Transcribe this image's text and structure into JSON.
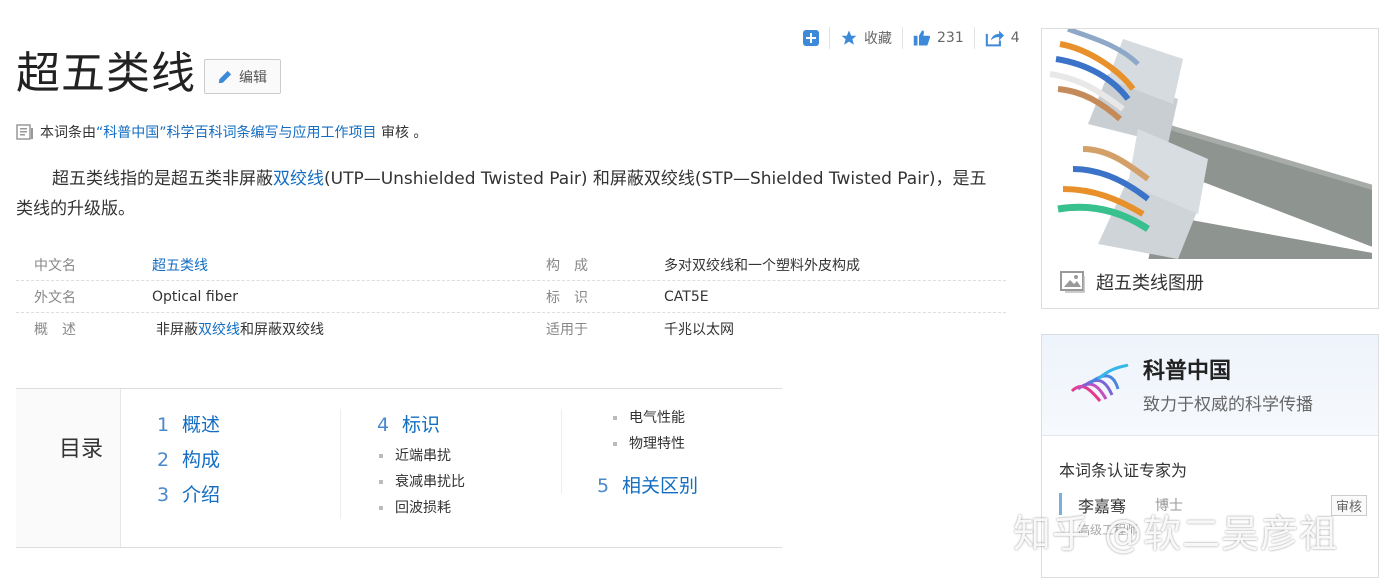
{
  "toolbar": {
    "favorite_label": "收藏",
    "like_count": "231",
    "share_count": "4"
  },
  "title": "超五类线",
  "edit_label": "编辑",
  "source": {
    "prefix": "本词条由",
    "link": "“科普中国”科学百科词条编写与应用工作项目",
    "suffix": " 审核 。"
  },
  "summary": {
    "part1": "超五类线指的是超五类非屏蔽",
    "link1": "双绞线",
    "part2": "(UTP—Unshielded Twisted Pair) 和屏蔽双绞线(STP—Shielded Twisted Pair)，是五类线的升级版。"
  },
  "info": [
    {
      "k1": "中文名",
      "v1": "超五类线",
      "k2": "构　成",
      "v2": "多对双绞线和一个塑料外皮构成"
    },
    {
      "k1": "外文名",
      "v1": "Optical fiber",
      "k2": "标　识",
      "v2": "CAT5E"
    },
    {
      "k1": "概　述",
      "v1a": "非屏蔽",
      "v1link": "双绞线",
      "v1b": "和屏蔽双绞线",
      "k2": "适用于",
      "v2": "千兆以太网"
    }
  ],
  "toc": {
    "label": "目录",
    "col1": [
      {
        "num": "1",
        "text": "概述"
      },
      {
        "num": "2",
        "text": "构成"
      },
      {
        "num": "3",
        "text": "介绍"
      }
    ],
    "col2_main": {
      "num": "4",
      "text": "标识"
    },
    "col2_subs": [
      "近端串扰",
      "衰减串扰比",
      "回波损耗"
    ],
    "col3_subs": [
      "电气性能",
      "物理特性"
    ],
    "col3_main": {
      "num": "5",
      "text": "相关区别"
    }
  },
  "album": {
    "caption": "超五类线图册"
  },
  "expert": {
    "org_name": "科普中国",
    "slogan": "致力于权威的科学传播",
    "title": "本词条认证专家为",
    "person": "李嘉骞",
    "degree": "博士",
    "badge": "审核",
    "org": "高级工程师"
  },
  "watermark": "知乎 @软二吴彦祖"
}
